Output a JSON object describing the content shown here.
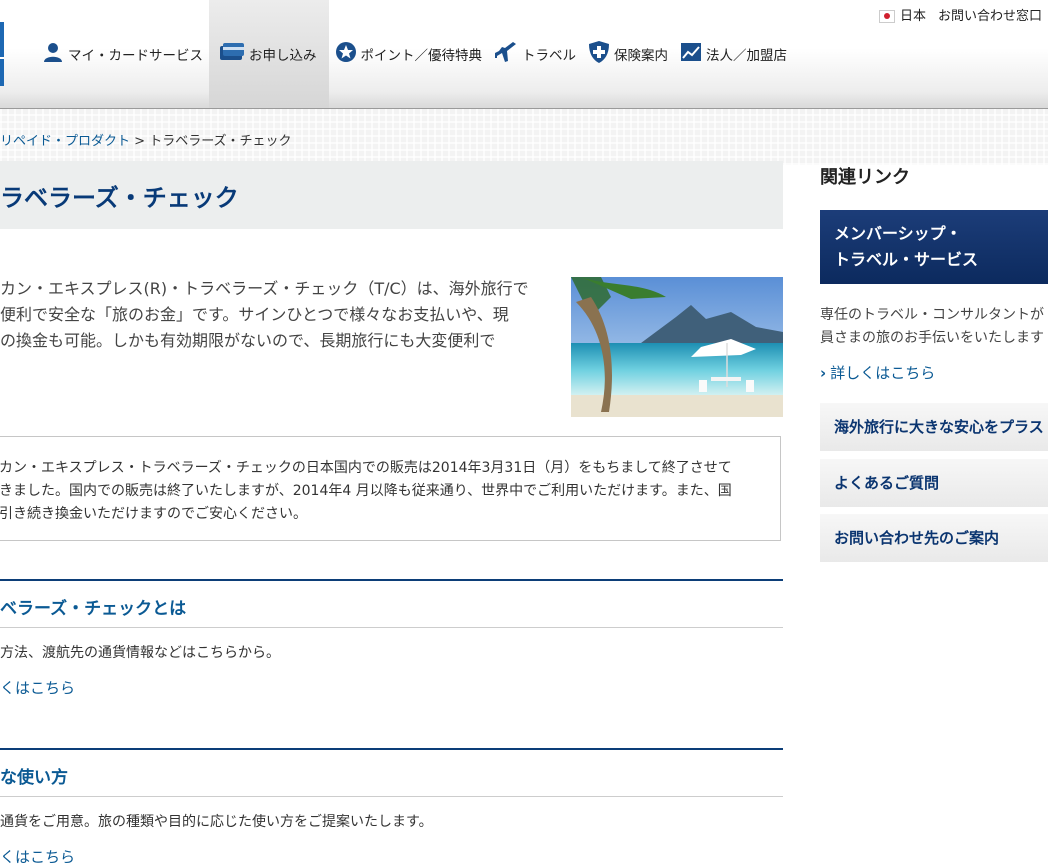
{
  "header": {
    "country": "日本",
    "contact": "お問い合わせ窓口",
    "nav": [
      {
        "label": "マイ・カードサービス",
        "icon": "person-icon"
      },
      {
        "label": "お申し込み",
        "icon": "card-icon"
      },
      {
        "label": "ポイント／優待特典",
        "icon": "star-badge-icon"
      },
      {
        "label": "トラベル",
        "icon": "airplane-icon"
      },
      {
        "label": "保険案内",
        "icon": "shield-cross-icon"
      },
      {
        "label": "法人／加盟店",
        "icon": "chart-icon"
      }
    ]
  },
  "breadcrumb": {
    "link": "リペイド・プロダクト",
    "separator": ">",
    "current": "トラベラーズ・チェック"
  },
  "main": {
    "title": "ラベラーズ・チェック",
    "intro": [
      "カン・エキスプレス(R)・トラベラーズ・チェック（T/C）は、海外旅行で",
      "便利で安全な「旅のお金」です。サインひとつで様々なお支払いや、現",
      "の換金も可能。しかも有効期限がないので、長期旅行にも大変便利で"
    ],
    "notice": [
      "カン・エキスプレス・トラベラーズ・チェックの日本国内での販売は2014年3月31日（月）をもちまして終了させて",
      "きました。国内での販売は終了いたしますが、2014年4 月以降も従来通り、世界中でご利用いただけます。また、国",
      "引き続き換金いただけますのでご安心ください。"
    ],
    "sections": [
      {
        "heading": "ベラーズ・チェックとは",
        "desc": "方法、渡航先の通貨情報などはこちらから。",
        "link": "くはこちら"
      },
      {
        "heading": "な使い方",
        "desc": "通貨をご用意。旅の種類や目的に応じた使い方をご提案いたします。",
        "link": "くはこちら"
      }
    ]
  },
  "sidebar": {
    "title": "関連リンク",
    "feature": [
      "メンバーシップ・",
      "トラベル・サービス"
    ],
    "desc": [
      "専任のトラベル・コンサルタントが",
      "員さまの旅のお手伝いをいたします"
    ],
    "more": "詳しくはこちら",
    "buttons": [
      "海外旅行に大きな安心をプラス",
      "よくあるご質問",
      "お問い合わせ先のご案内"
    ]
  }
}
